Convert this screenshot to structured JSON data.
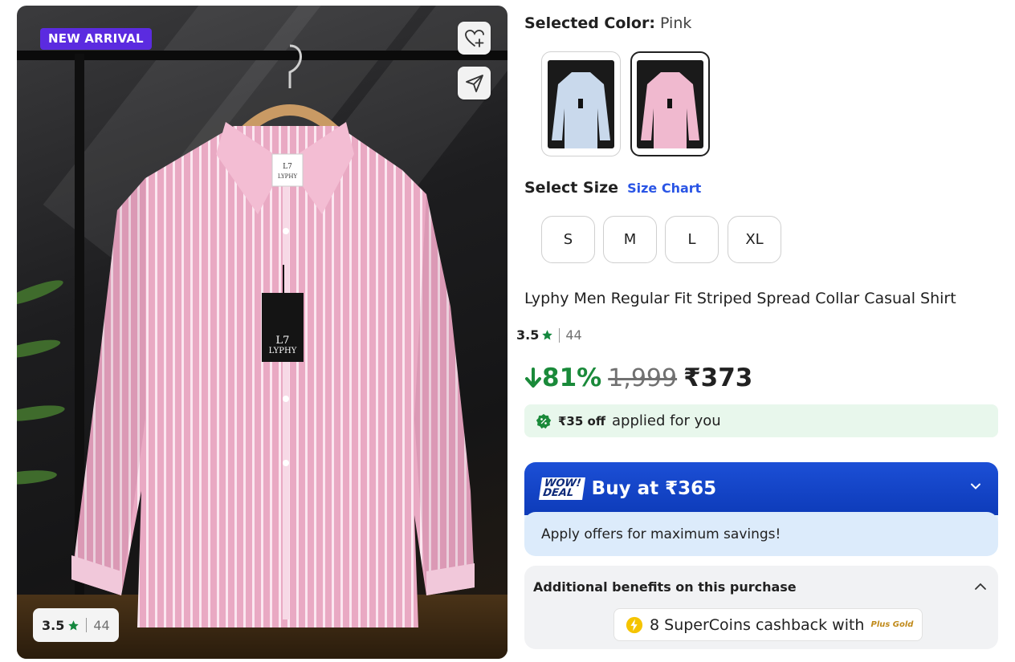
{
  "hero": {
    "badge": "NEW ARRIVAL",
    "rating": "3.5",
    "rating_count": "44",
    "brand_tag": "LYPHY",
    "brand_logo": "L7",
    "wishlist_icon": "heart-plus-icon",
    "share_icon": "send-icon"
  },
  "color": {
    "label": "Selected Color:",
    "value": "Pink",
    "options": [
      {
        "name": "Light Blue",
        "swatch": "#c9d9ec"
      },
      {
        "name": "Pink",
        "swatch": "#f0b9cf"
      }
    ],
    "selected_index": 1
  },
  "size": {
    "label": "Select Size",
    "chart_link": "Size Chart",
    "options": [
      "S",
      "M",
      "L",
      "XL"
    ]
  },
  "product": {
    "title": "Lyphy Men Regular Fit Striped Spread Collar Casual Shirt",
    "rating": "3.5",
    "rating_count": "44"
  },
  "price": {
    "discount": "81%",
    "mrp": "1,999",
    "selling": "₹373"
  },
  "coupon": {
    "amount": "₹35 off",
    "text": "applied for you"
  },
  "deal": {
    "badge_line1": "WOW!",
    "badge_line2": "DEAL",
    "buy_text": "Buy at ₹365",
    "sub_text": "Apply offers for maximum savings!"
  },
  "benefits": {
    "title": "Additional benefits on this purchase",
    "coins_text": "8 SuperCoins cashback with",
    "plus_gold": "Plus Gold"
  },
  "colors": {
    "accent_purple": "#5b2be0",
    "discount_green": "#1a8a3a",
    "deal_blue": "#0d3bb9",
    "link_blue": "#2a55e5"
  }
}
